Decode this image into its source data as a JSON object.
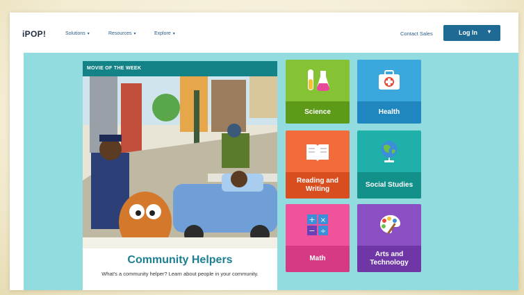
{
  "nav": {
    "logo": "iPOP!",
    "items": [
      "Solutions",
      "Resources",
      "Explore"
    ],
    "contact": "Contact Sales",
    "login": "Log In"
  },
  "feature": {
    "badge": "MOVIE OF THE WEEK",
    "title": "Community Helpers",
    "description": "What's a community helper? Learn about people in your community."
  },
  "tiles": [
    {
      "label": "Science",
      "icon": "flask-icon",
      "top_color": "#85c334",
      "bottom_color": "#5d9a18"
    },
    {
      "label": "Health",
      "icon": "first-aid-kit-icon",
      "top_color": "#3aa7dd",
      "bottom_color": "#1f86bf"
    },
    {
      "label": "Reading and Writing",
      "icon": "book-icon",
      "top_color": "#f26b3a",
      "bottom_color": "#d94e1f"
    },
    {
      "label": "Social Studies",
      "icon": "globe-icon",
      "top_color": "#1eb0a9",
      "bottom_color": "#12908a"
    },
    {
      "label": "Math",
      "icon": "calculator-icon",
      "top_color": "#f0529c",
      "bottom_color": "#d73a84"
    },
    {
      "label": "Arts and Technology",
      "icon": "palette-icon",
      "top_color": "#8a4fc2",
      "bottom_color": "#6f36a6"
    }
  ]
}
